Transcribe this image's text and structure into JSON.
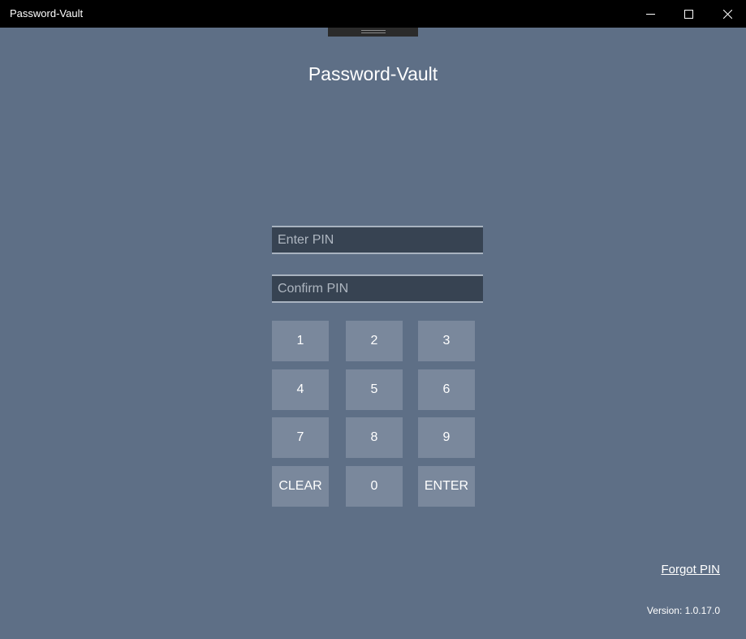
{
  "window": {
    "title": "Password-Vault",
    "controls": {
      "minimize": "minimize-icon",
      "maximize": "maximize-icon",
      "close": "close-icon"
    }
  },
  "app": {
    "heading": "Password-Vault"
  },
  "pin": {
    "enter_placeholder": "Enter PIN",
    "enter_value": "",
    "confirm_placeholder": "Confirm PIN",
    "confirm_value": ""
  },
  "keypad": {
    "keys": [
      "1",
      "2",
      "3",
      "4",
      "5",
      "6",
      "7",
      "8",
      "9",
      "CLEAR",
      "0",
      "ENTER"
    ]
  },
  "footer": {
    "forgot_label": "Forgot PIN",
    "version": "Version: 1.0.17.0"
  },
  "colors": {
    "background": "#5e6f86",
    "titlebar": "#000000",
    "field_bg": "#374352",
    "key_bg": "#7a889c",
    "text": "#ffffff"
  }
}
